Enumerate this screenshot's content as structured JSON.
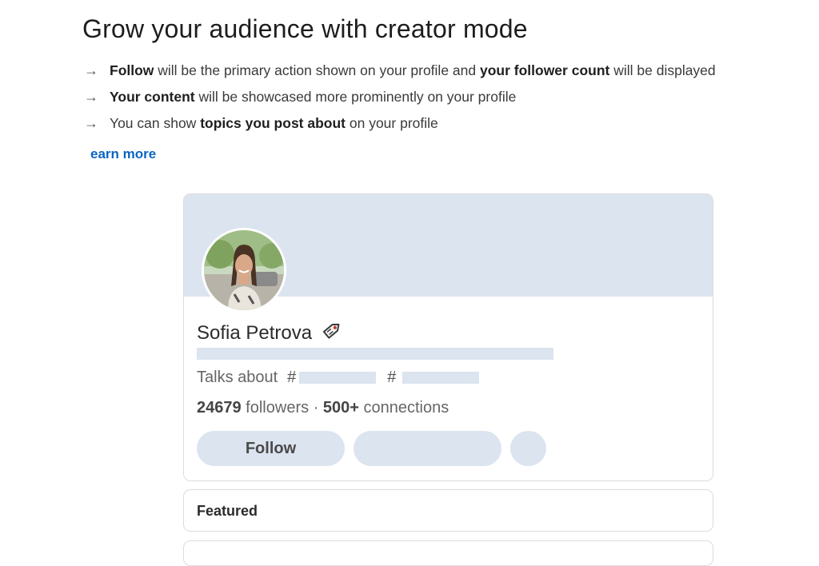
{
  "title": "Grow your audience with creator mode",
  "bullets": [
    {
      "b1": "Follow",
      "t1": " will be the primary action shown on your profile and ",
      "b2": "your follower count",
      "t2": " will be displayed"
    },
    {
      "b1": "Your content",
      "t1": " will be showcased more prominently on your profile",
      "b2": "",
      "t2": ""
    },
    {
      "pre": "You can show ",
      "b1": "topics you post about",
      "t1": " on your profile"
    }
  ],
  "arrow_glyph": "→",
  "learn_more": "earn more",
  "profile": {
    "name": "Sofia Petrova",
    "badge_icon": "tag-icon",
    "talks_about_label": "Talks about",
    "hash": "#",
    "followers_count": "24679",
    "followers_label": " followers · ",
    "connections_count": "500+",
    "connections_label": " connections",
    "follow_label": "Follow"
  },
  "featured_label": "Featured",
  "colors": {
    "accent": "#0a66c2",
    "placeholder": "#dbe4ef"
  }
}
